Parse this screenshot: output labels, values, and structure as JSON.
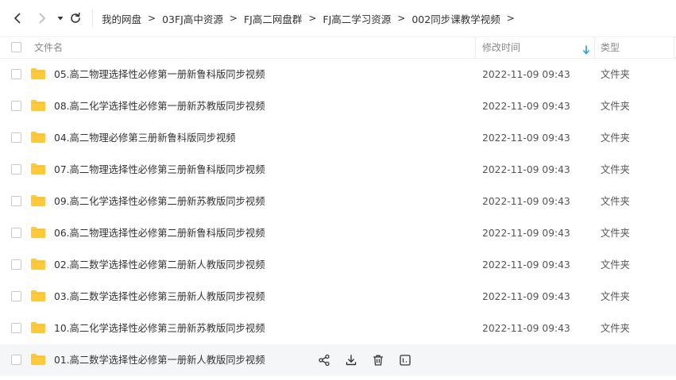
{
  "breadcrumb": [
    "我的网盘",
    "03FJ高中资源",
    "FJ高二网盘群",
    "FJ高二学习资源",
    "002同步课教学视频"
  ],
  "breadcrumb_separator": ">",
  "header": {
    "name": "文件名",
    "modified": "修改时间",
    "type": "类型",
    "sort": "descending"
  },
  "icons": {
    "back": "chevron-left-icon",
    "forward": "chevron-right-icon",
    "dropdown": "caret-down-icon",
    "refresh": "refresh-icon",
    "folder": "folder-icon",
    "share": "share-icon",
    "download": "download-icon",
    "delete": "trash-icon",
    "more": "more-icon"
  },
  "colors": {
    "folder": "#FFC93D",
    "accent": "#1E9FD8"
  },
  "files": [
    {
      "name": "05.高二物理选择性必修第一册新鲁科版同步视频",
      "modified": "2022-11-09 09:43",
      "type": "文件夹"
    },
    {
      "name": "08.高二化学选择性必修第一册新苏教版同步视频",
      "modified": "2022-11-09 09:43",
      "type": "文件夹"
    },
    {
      "name": "04.高二物理必修第三册新鲁科版同步视频",
      "modified": "2022-11-09 09:43",
      "type": "文件夹"
    },
    {
      "name": "07.高二物理选择性必修第三册新鲁科版同步视频",
      "modified": "2022-11-09 09:43",
      "type": "文件夹"
    },
    {
      "name": "09.高二化学选择性必修第二册新苏教版同步视频",
      "modified": "2022-11-09 09:43",
      "type": "文件夹"
    },
    {
      "name": "06.高二物理选择性必修第二册新鲁科版同步视频",
      "modified": "2022-11-09 09:43",
      "type": "文件夹"
    },
    {
      "name": "02.高二数学选择性必修第二册新人教版同步视频",
      "modified": "2022-11-09 09:43",
      "type": "文件夹"
    },
    {
      "name": "03.高二数学选择性必修第三册新人教版同步视频",
      "modified": "2022-11-09 09:43",
      "type": "文件夹"
    },
    {
      "name": "10.高二化学选择性必修第三册新苏教版同步视频",
      "modified": "2022-11-09 09:43",
      "type": "文件夹"
    },
    {
      "name": "01.高二数学选择性必修第一册新人教版同步视频",
      "modified": "",
      "type": "",
      "hovered": true
    }
  ]
}
